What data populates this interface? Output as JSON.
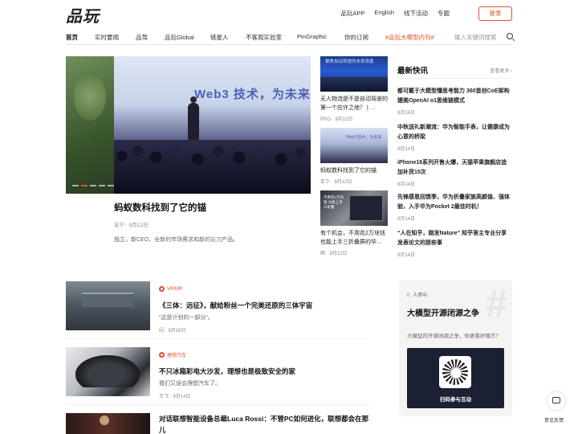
{
  "header": {
    "logo": "品玩",
    "links": [
      "品玩APP",
      "English",
      "线下活动",
      "专题"
    ],
    "login": "登录"
  },
  "nav": {
    "items": [
      "首页",
      "实时要闻",
      "品驾",
      "品玩Global",
      "链星人",
      "不客观实验室",
      "PinGraphic",
      "你的订阅",
      "#品玩大模型内刊#"
    ],
    "search_placeholder": "输入关键词搜索"
  },
  "hero": {
    "image_text": "Web3 技术，为未来",
    "title": "蚂蚁数科找到了它的锚",
    "meta": "玄宁 · 9月12日",
    "desc": "独立，新CEO，全新的市场需求和新的尖刀产品。",
    "slide_index": 1,
    "slide_total": 5
  },
  "mid": [
    {
      "title": "无人物流是不是自动驾驶的第一个应许之地？ | …",
      "meta": "PRO · 9月12日",
      "thumb_text": "聚焦自动驾驶的未来场景"
    },
    {
      "title": "蚂蚁数科找到了它的锚",
      "meta": "玄宁 · 9月12日",
      "thumb_text": "Web3 技术，为未来"
    },
    {
      "title": "有个机会，不用花2万块钱也能上手三折叠屏的华…",
      "meta": "雨 · 9月12日",
      "thumb_text": "不用花2万块钱 也能上手 三折叠"
    }
  ],
  "news": {
    "title": "最新快讯",
    "more": "查看更多",
    "items": [
      {
        "title": "都可戴于大模型懂思考能力 360首创CoE架构 媲美OpenAI o1思维链模式",
        "date": "9月16日"
      },
      {
        "title": "中秋送礼新潮流：华为智能手表，让健康成为心意的桥梁",
        "date": "9月14日"
      },
      {
        "title": "iPhone16系列开售火爆，天猫苹果旗舰店追加补货15次",
        "date": "9月14日"
      },
      {
        "title": "先锋感恩回馈季，华为折叠家族高颜值、强体验，入手华为Pocket 2最佳时机！",
        "date": "9月14日"
      },
      {
        "title": "“人在知乎，刚发Nature” 知乎答主专业分享发表论文的那些事",
        "date": "9月14日"
      }
    ]
  },
  "list": [
    {
      "tag": "VR/MR",
      "title": "《三体：远征》，献给粉丝一个完美还原的三体宇宙",
      "desc": "“这是计划的一部分”。",
      "meta": "闷 · 9月16日"
    },
    {
      "tag": "理想汽车",
      "title": "不只冰箱彩电大沙发，理想也是极致安全的家",
      "desc": "我们又误会理想汽车了。",
      "meta": "王飞 · 9月14日"
    },
    {
      "tag": "",
      "title": "对话联想智能设备总裁Luca Rossi：不管PC如何进化，联想都会在那儿",
      "desc": "",
      "meta": ""
    }
  ],
  "debate": {
    "count": "0",
    "count_suffix": "人参与",
    "title": "大模型开源闭源之争",
    "question": "大模型的开源闭源之争，你更看好哪方？",
    "qr_center": "品玩",
    "qr_label": "扫码参与互动"
  },
  "feedback": "意见反馈",
  "colors": {
    "accent": "#e0502b"
  }
}
